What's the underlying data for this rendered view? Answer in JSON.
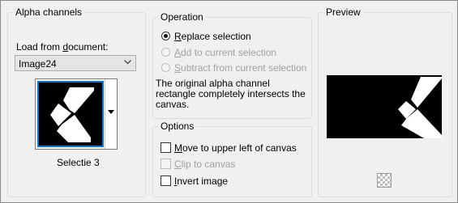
{
  "alpha_channels": {
    "title": "Alpha channels",
    "load_label": "Load from document:",
    "document_value": "Image24",
    "thumbnail_caption": "Selectie 3"
  },
  "operation": {
    "title": "Operation",
    "options": [
      {
        "label": "Replace selection",
        "selected": true,
        "enabled": true
      },
      {
        "label": "Add to current selection",
        "selected": false,
        "enabled": false
      },
      {
        "label": "Subtract from current selection",
        "selected": false,
        "enabled": false
      }
    ],
    "message": "The original alpha channel rectangle completely intersects the canvas."
  },
  "options": {
    "title": "Options",
    "items": [
      {
        "label": "Move to upper left of canvas",
        "checked": false,
        "enabled": true
      },
      {
        "label": "Clip to canvas",
        "checked": false,
        "enabled": false
      },
      {
        "label": "Invert image",
        "checked": false,
        "enabled": true
      }
    ]
  },
  "preview": {
    "title": "Preview",
    "background_icon": "transparency-checker-icon"
  }
}
